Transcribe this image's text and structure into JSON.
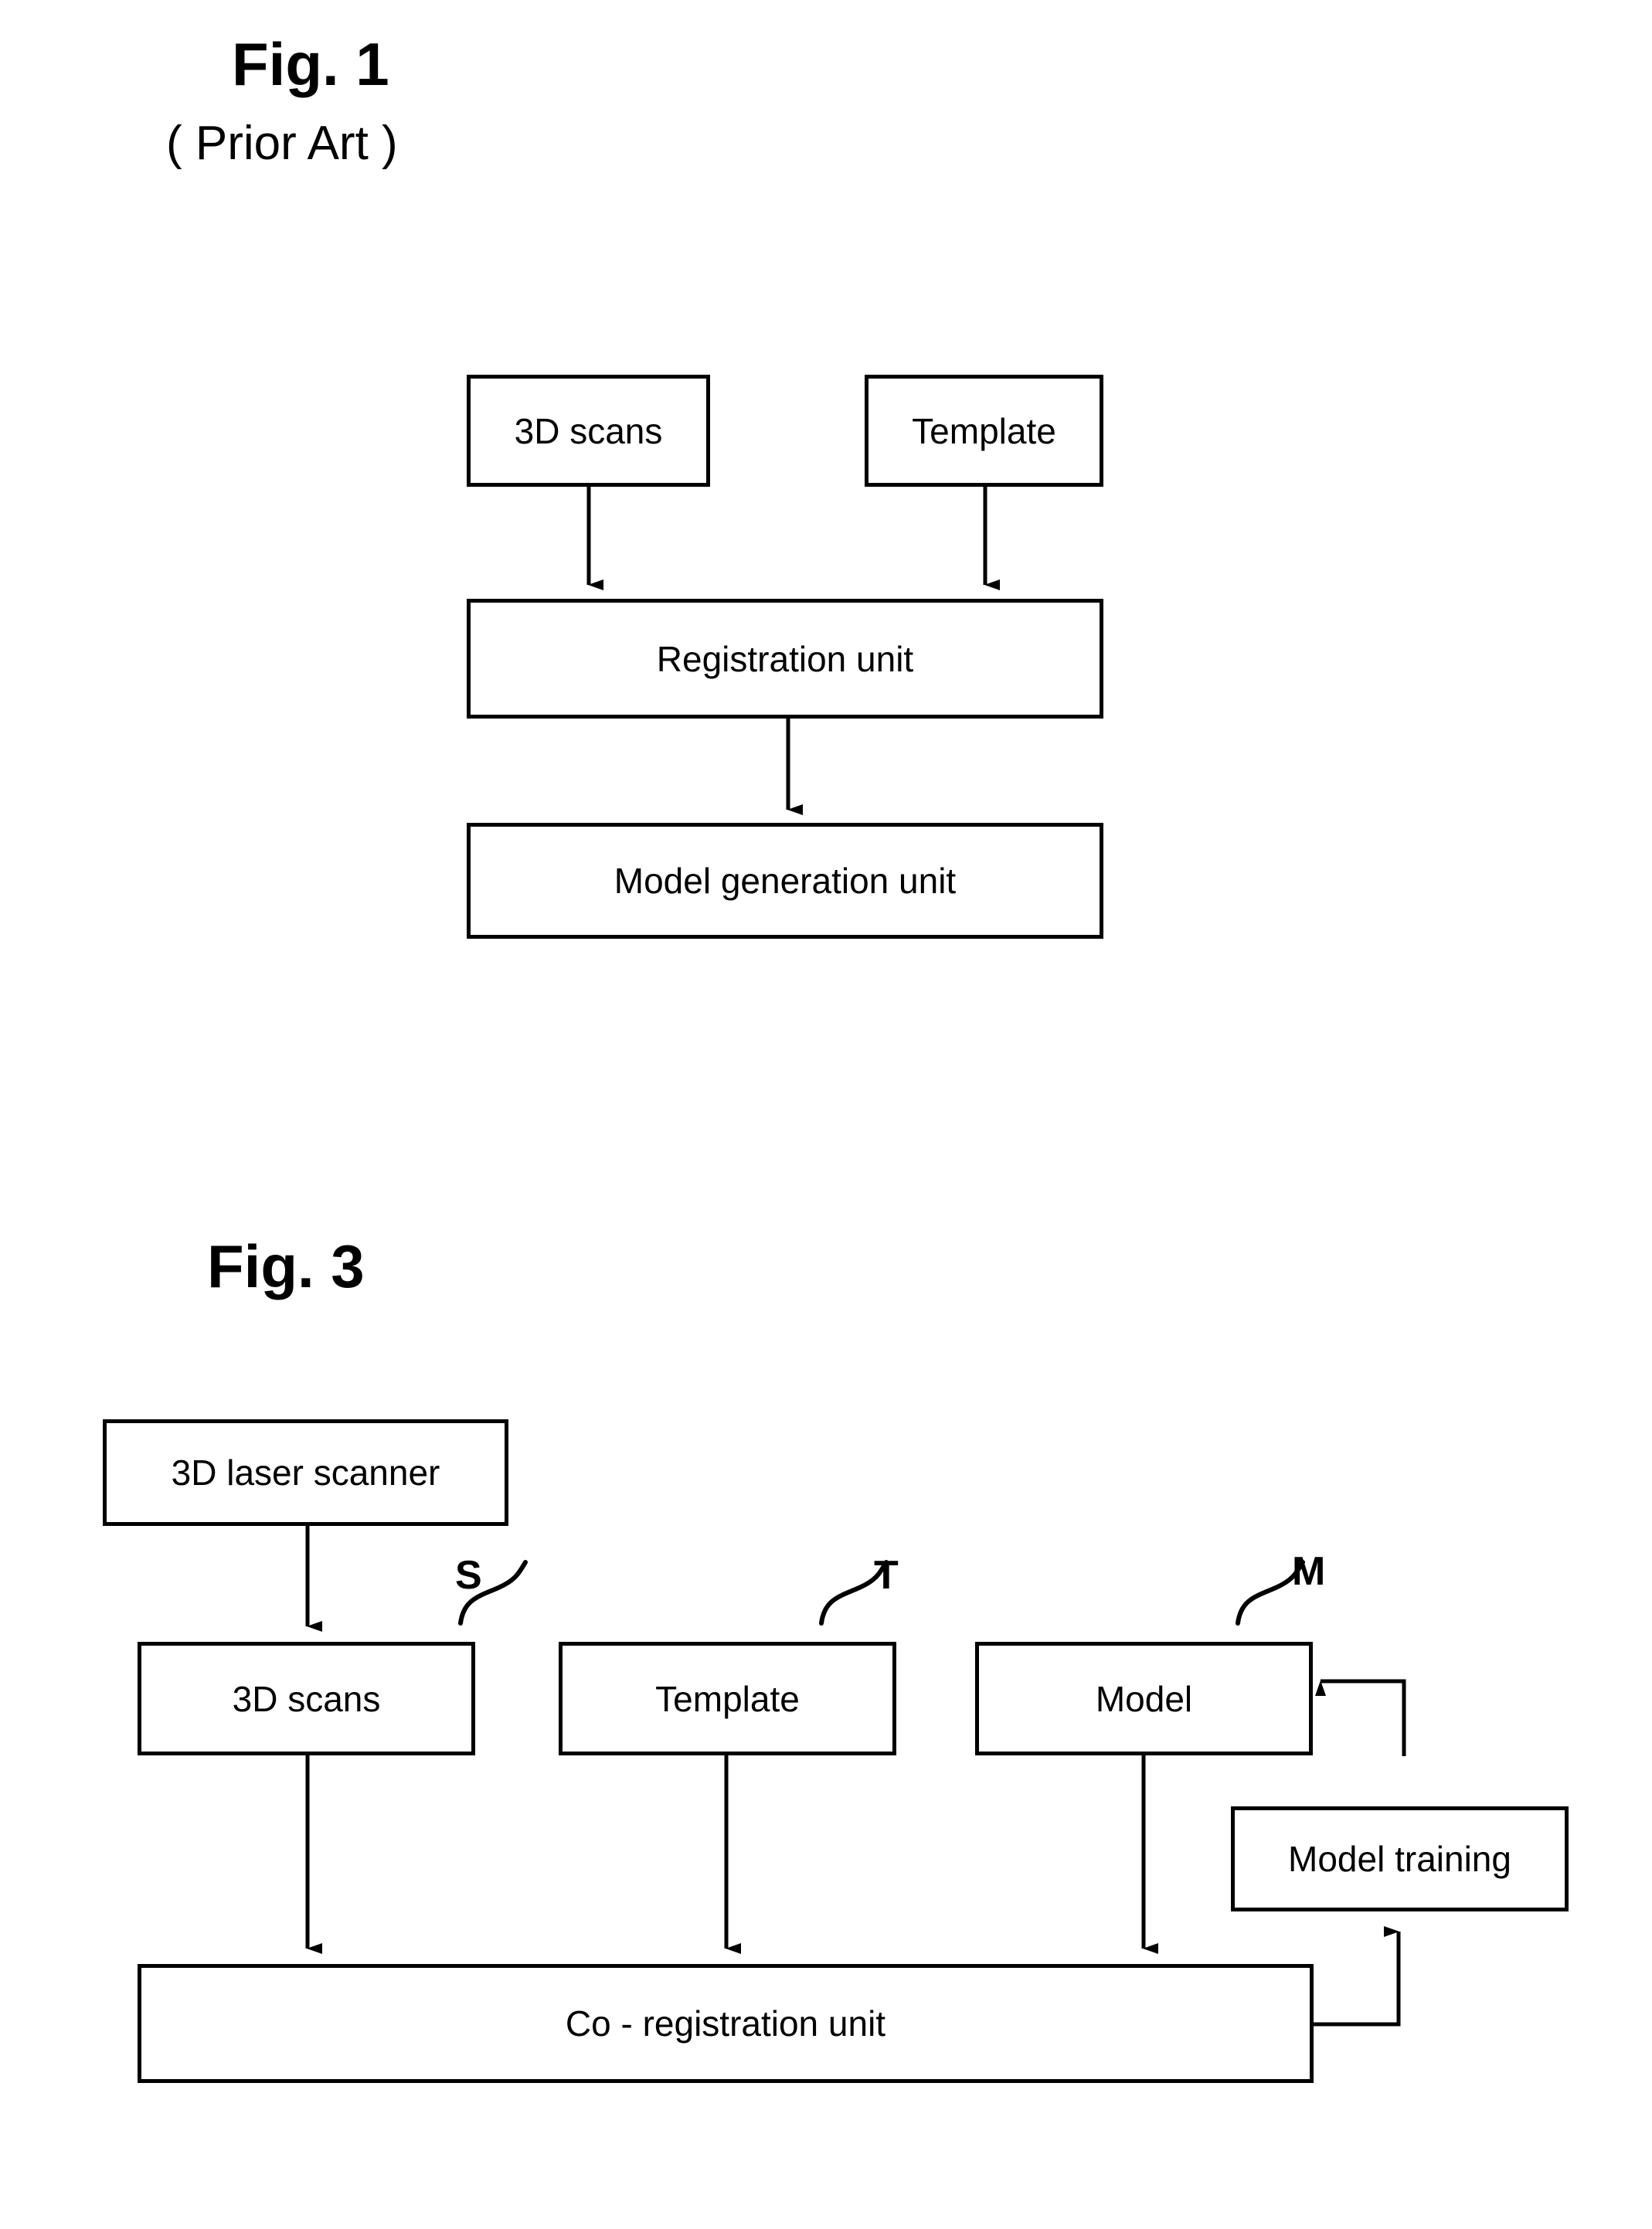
{
  "figures": [
    {
      "id": "fig1",
      "title": "Fig. 1",
      "subtitle": "( Prior Art )",
      "boxes": [
        {
          "id": "f1-3d-scans",
          "label": "3D scans"
        },
        {
          "id": "f1-template",
          "label": "Template"
        },
        {
          "id": "f1-registration",
          "label": "Registration unit"
        },
        {
          "id": "f1-modelgen",
          "label": "Model generation unit"
        }
      ],
      "connections": [
        {
          "from": "3D scans",
          "to": "Registration unit",
          "arrow": "down"
        },
        {
          "from": "Template",
          "to": "Registration unit",
          "arrow": "down"
        },
        {
          "from": "Registration unit",
          "to": "Model generation unit",
          "arrow": "down"
        }
      ]
    },
    {
      "id": "fig3",
      "title": "Fig. 3",
      "subtitle": "",
      "boxes": [
        {
          "id": "f3-scanner",
          "label": "3D laser scanner"
        },
        {
          "id": "f3-3d-scans",
          "label": "3D scans",
          "ref": "S"
        },
        {
          "id": "f3-template",
          "label": "Template",
          "ref": "T"
        },
        {
          "id": "f3-model",
          "label": "Model",
          "ref": "M"
        },
        {
          "id": "f3-training",
          "label": "Model training"
        },
        {
          "id": "f3-coreg",
          "label": "Co - registration unit"
        }
      ],
      "reference_letters": [
        "S",
        "T",
        "M"
      ],
      "connections": [
        {
          "from": "3D laser scanner",
          "to": "3D scans",
          "arrow": "down"
        },
        {
          "from": "3D scans",
          "to": "Co - registration unit",
          "arrow": "down"
        },
        {
          "from": "Template",
          "to": "Co - registration unit",
          "arrow": "down"
        },
        {
          "from": "Model",
          "to": "Co - registration unit",
          "arrow": "down"
        },
        {
          "from": "Co - registration unit",
          "to": "Model training",
          "arrow": "up"
        },
        {
          "from": "Model training",
          "to": "Model",
          "arrow": "left"
        }
      ]
    }
  ],
  "colors": {
    "ink": "#000000",
    "paper": "#ffffff"
  }
}
